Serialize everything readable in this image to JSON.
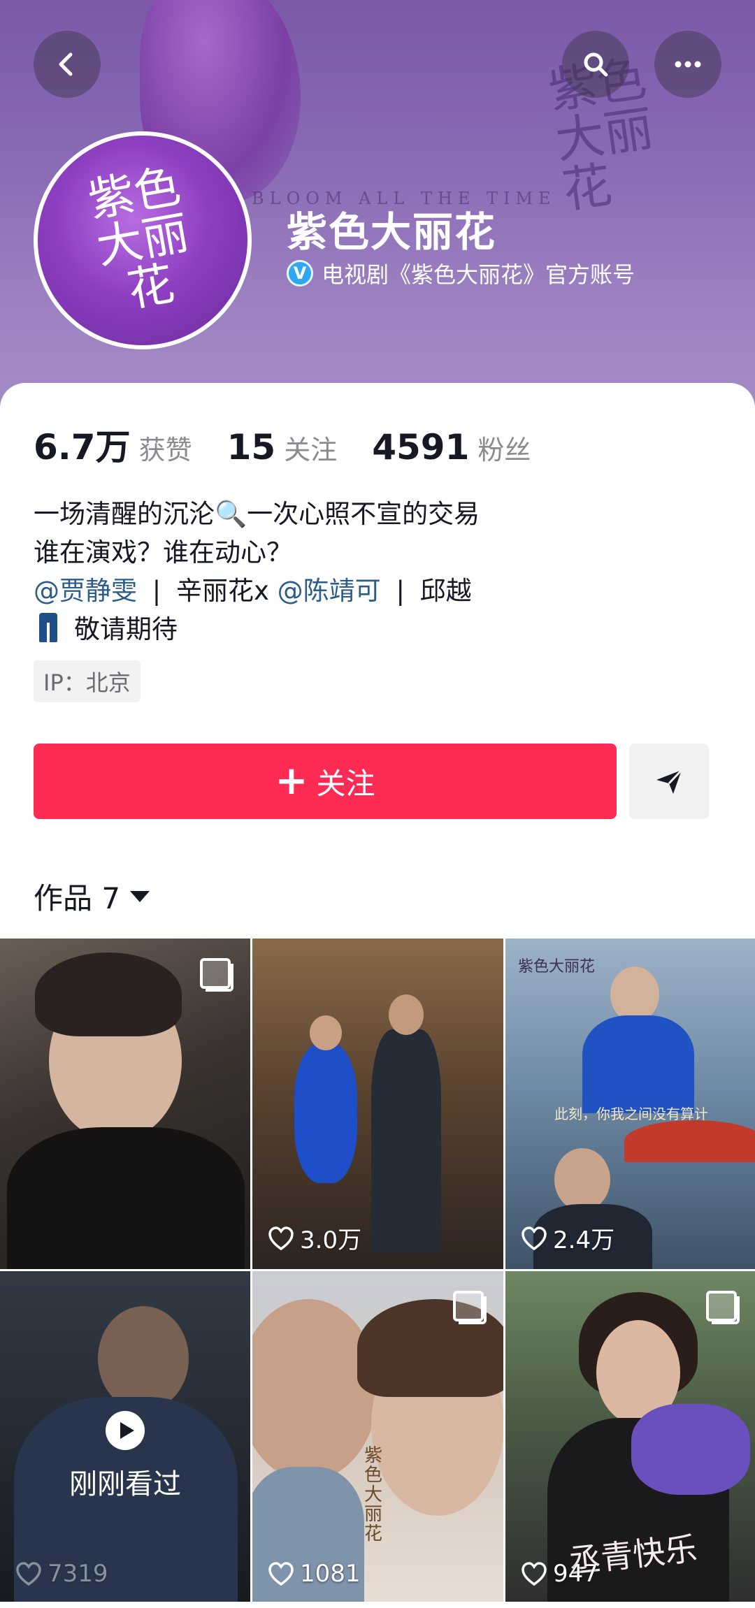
{
  "profile": {
    "name": "紫色大丽花",
    "verification": "电视剧《紫色大丽花》官方账号",
    "verify_badge": "V",
    "avatar_text": "紫色大丽花",
    "banner_text": "BLOOM ALL THE TIME",
    "banner_calligraphy": "紫色大丽花"
  },
  "stats": [
    {
      "num": "6.7万",
      "label": "获赞"
    },
    {
      "num": "15",
      "label": "关注"
    },
    {
      "num": "4591",
      "label": "粉丝"
    }
  ],
  "bio": {
    "line1": "一场清醒的沉沦🔍一次心照不宣的交易",
    "line2": "谁在演戏？谁在动心？",
    "line3": {
      "mention1": "@贾静雯",
      "sep1": "|",
      "mid": "辛丽花x",
      "mention2": "@陈靖可",
      "sep2": "|",
      "end": "邱越"
    },
    "line4": "敬请期待"
  },
  "ip": "IP：北京",
  "actions": {
    "follow_label": "关注",
    "follow_plus": "+"
  },
  "tabs": {
    "works_label": "作品 7"
  },
  "videos": [
    {
      "likes": "",
      "multi": true
    },
    {
      "likes": "3.0万",
      "multi": false
    },
    {
      "likes": "2.4万",
      "multi": false,
      "caption": "此刻，你我之间没有算计",
      "poster_title": "紫色大丽花"
    },
    {
      "likes": "7319",
      "multi": false,
      "watched": "刚刚看过"
    },
    {
      "likes": "1081",
      "multi": true,
      "poster_title": "紫色大丽花"
    },
    {
      "likes": "947",
      "multi": true,
      "caption": "丞青快乐"
    }
  ],
  "colors": {
    "follow": "#fe2c55",
    "mention": "#2b5c8a",
    "banner": "#8a6bb5"
  }
}
